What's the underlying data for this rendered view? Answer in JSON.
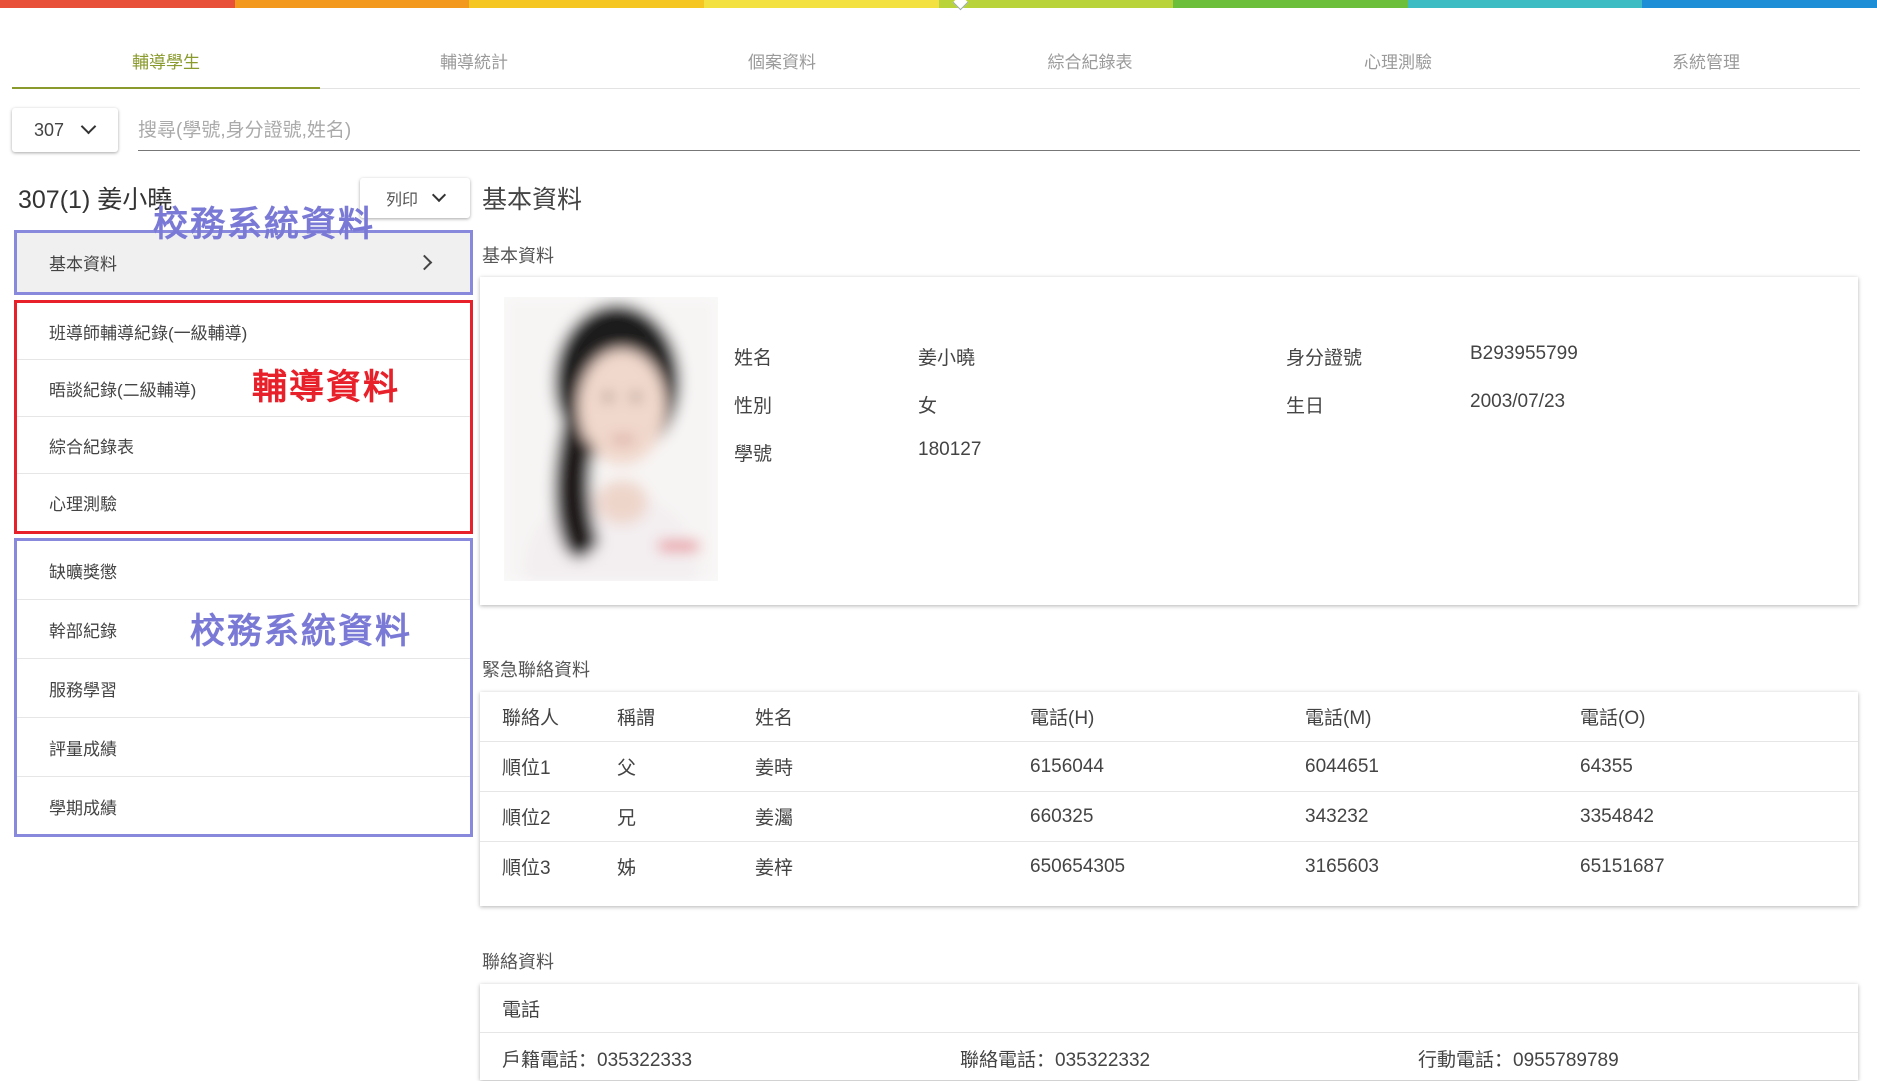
{
  "topbar_colors": [
    "#e8503a",
    "#f39a1e",
    "#f5c622",
    "#f3e142",
    "#b9d33b",
    "#6bbf3a",
    "#3dbcc4",
    "#1e8fd6"
  ],
  "tabs": [
    {
      "label": "輔導學生",
      "active": true
    },
    {
      "label": "輔導統計",
      "active": false
    },
    {
      "label": "個案資料",
      "active": false
    },
    {
      "label": "綜合紀錄表",
      "active": false
    },
    {
      "label": "心理測驗",
      "active": false
    },
    {
      "label": "系統管理",
      "active": false
    }
  ],
  "class_select": {
    "value": "307"
  },
  "search": {
    "placeholder": "搜尋(學號,身分證號,姓名)"
  },
  "student_header": "307(1) 姜小曉",
  "print_button": "列印",
  "menu": {
    "group1": {
      "items": [
        {
          "label": "基本資料"
        }
      ],
      "annotation": "校務系統資料"
    },
    "group2": {
      "items": [
        {
          "label": "班導師輔導紀錄(一級輔導)"
        },
        {
          "label": "晤談紀錄(二級輔導)"
        },
        {
          "label": "綜合紀錄表"
        },
        {
          "label": "心理測驗"
        }
      ],
      "annotation": "輔導資料"
    },
    "group3": {
      "items": [
        {
          "label": "缺曠獎懲"
        },
        {
          "label": "幹部紀錄"
        },
        {
          "label": "服務學習"
        },
        {
          "label": "評量成績"
        },
        {
          "label": "學期成績"
        }
      ],
      "annotation": "校務系統資料"
    }
  },
  "main": {
    "title": "基本資料",
    "basic_section_title": "基本資料",
    "basic": {
      "name_label": "姓名",
      "name": "姜小曉",
      "id_label": "身分證號",
      "id": "B293955799",
      "gender_label": "性別",
      "gender": "女",
      "birthday_label": "生日",
      "birthday": "2003/07/23",
      "student_no_label": "學號",
      "student_no": "180127"
    },
    "emergency_section_title": "緊急聯絡資料",
    "emergency": {
      "headers": [
        "聯絡人",
        "稱謂",
        "姓名",
        "電話(H)",
        "電話(M)",
        "電話(O)"
      ],
      "rows": [
        [
          "順位1",
          "父",
          "姜時",
          "6156044",
          "6044651",
          "64355"
        ],
        [
          "順位2",
          "兄",
          "姜灟",
          "660325",
          "343232",
          "3354842"
        ],
        [
          "順位3",
          "姊",
          "姜梓",
          "650654305",
          "3165603",
          "65151687"
        ]
      ]
    },
    "contact_section_title": "聯絡資料",
    "contact": {
      "phone_header": "電話",
      "household_phone": "戶籍電話：035322333",
      "contact_phone": "聯絡電話：035322332",
      "mobile_phone": "行動電話：0955789789"
    }
  }
}
